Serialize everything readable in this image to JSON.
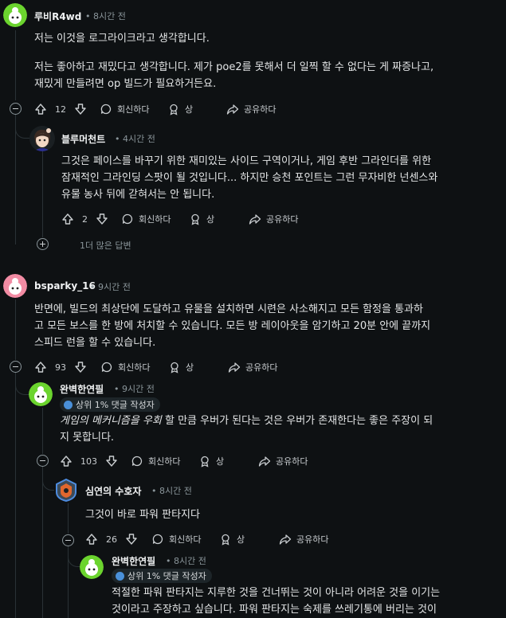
{
  "comments": [
    {
      "author": "루비R4wd",
      "time": "• 8시간 전",
      "lines": [
        "저는 이것을 로그라이크라고 생각합니다.",
        "",
        "저는 좋아하고 재밌다고 생각합니다. 제가 poe2를 못해서 더 일찍 할 수 없다는 게 짜증나고,",
        "재밌게 만들려면 op 빌드가 필요하거든요."
      ],
      "votes": "12",
      "reply": "회신하다",
      "award": "상",
      "share": "공유하다"
    },
    {
      "author": "블루머천트",
      "time": "• 4시간 전",
      "lines": [
        "그것은 페이스를 바꾸기 위한 재미있는 사이드 구역이거나, 게임 후반 그라인더를 위한",
        "잠재적인 그라인딩 스팟이 될 것입니다... 하지만 승천 포인트는 그런 무자비한 넌센스와",
        "유물 농사 뒤에 갇혀서는 안 됩니다."
      ],
      "votes": "2",
      "reply": "회신하다",
      "award": "상",
      "share": "공유하다",
      "more": "1더 많은 답변"
    },
    {
      "author": "bsparky_16",
      "time": "• 9시간 전",
      "lines": [
        "반면에, 빌드의 최상단에 도달하고 유물을 설치하면 시련은 사소해지고 모든 함정을 통과하",
        "고 모든 보스를 한 방에 처치할 수 있습니다. 모든 방 레이아웃을 암기하고 20분 안에 끝까지",
        "스피드 런을 할 수 있습니다."
      ],
      "votes": "93",
      "reply": "회신하다",
      "award": "상",
      "share": "공유하다"
    },
    {
      "author": "완벽한연필",
      "time": "• 9시간 전",
      "badge": "상위 1% 댓글 작성자",
      "italic": "게임의 메커니즘을 우회",
      "line1_rest": " 할 만큼 우버가 된다는 것은 우버가 존재한다는 좋은 주장이 되",
      "line2": "지 못합니다.",
      "votes": "103",
      "reply": "회신하다",
      "award": "상",
      "share": "공유하다"
    },
    {
      "author": "심연의 수호자",
      "time": "• 8시간 전",
      "lines": [
        "그것이 바로 파워 판타지다"
      ],
      "votes": "26",
      "reply": "회신하다",
      "award": "상",
      "share": "공유하다"
    },
    {
      "author": "완벽한연필",
      "time": "• 8시간 전",
      "badge": "상위 1% 댓글 작성자",
      "lines": [
        "적절한 파워 판타지는 지루한 것을 건너뛰는 것이 아니라 어려운 것을 이기는",
        "것이라고 주장하고 싶습니다. 파워 판타지는 숙제를 쓰레기통에 버리는 것이"
      ]
    }
  ],
  "colors": {
    "background": "#0e1113",
    "accent_snoo": "#6bd42e",
    "accent_pink": "#f28ca4"
  },
  "icons": [
    "upvote-icon",
    "downvote-icon",
    "comment-icon",
    "award-icon",
    "share-icon",
    "collapse-icon",
    "expand-icon",
    "snoo-avatar",
    "shield-avatar"
  ]
}
